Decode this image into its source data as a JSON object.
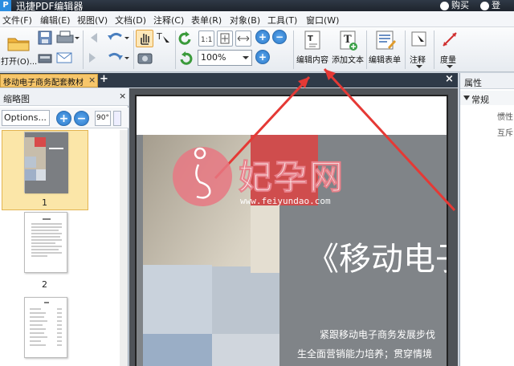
{
  "app": {
    "title": "迅捷PDF编辑器",
    "logo": "P",
    "buy": "购买",
    "login": "登"
  },
  "menu": [
    "文件(F)",
    "编辑(E)",
    "视图(V)",
    "文档(D)",
    "注释(C)",
    "表单(R)",
    "对象(B)",
    "工具(T)",
    "窗口(W)"
  ],
  "toolbar": {
    "open": "打开(O)...",
    "zoom": "100%",
    "edit_content": "编辑内容",
    "add_text": "添加文本",
    "edit_form": "编辑表单",
    "annotate": "注释",
    "measure": "度量"
  },
  "tab": {
    "doc_name": "移动电子商务配套教材",
    "close": "×",
    "new": "+",
    "close_doc": "×"
  },
  "thumbs": {
    "title": "缩略图",
    "close": "×",
    "options": "Options...",
    "zoom_in": "+",
    "zoom_out": "−",
    "rotate": "90°",
    "pages": [
      "1",
      "2"
    ]
  },
  "page": {
    "title": "《移动电子",
    "line1": "紧跟移动电子商务发展步伐",
    "line2": "生全面营销能力培养；贯穿情境"
  },
  "properties": {
    "title": "属性",
    "section": "常规",
    "rows": [
      "惯性",
      "互斥"
    ]
  },
  "watermark": {
    "brand": "妃孕网",
    "url": "www.feiyundao.com"
  }
}
